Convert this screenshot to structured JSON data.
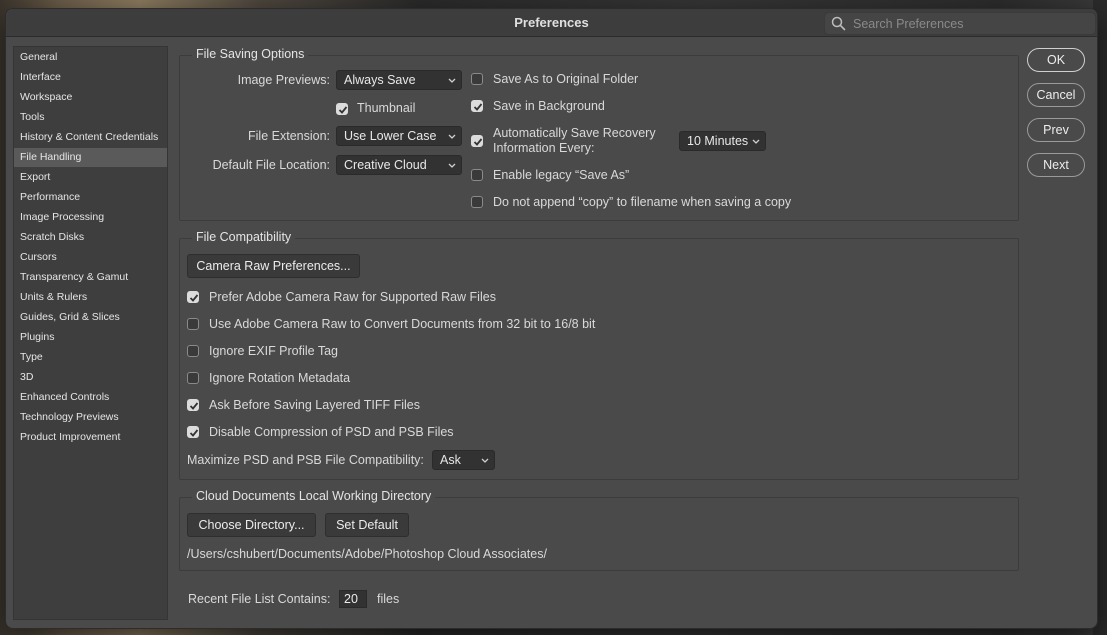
{
  "window": {
    "title": "Preferences"
  },
  "search": {
    "placeholder": "Search Preferences"
  },
  "sidebar": {
    "items": [
      {
        "label": "General"
      },
      {
        "label": "Interface"
      },
      {
        "label": "Workspace"
      },
      {
        "label": "Tools"
      },
      {
        "label": "History & Content Credentials"
      },
      {
        "label": "File Handling"
      },
      {
        "label": "Export"
      },
      {
        "label": "Performance"
      },
      {
        "label": "Image Processing"
      },
      {
        "label": "Scratch Disks"
      },
      {
        "label": "Cursors"
      },
      {
        "label": "Transparency & Gamut"
      },
      {
        "label": "Units & Rulers"
      },
      {
        "label": "Guides, Grid & Slices"
      },
      {
        "label": "Plugins"
      },
      {
        "label": "Type"
      },
      {
        "label": "3D"
      },
      {
        "label": "Enhanced Controls"
      },
      {
        "label": "Technology Previews"
      },
      {
        "label": "Product Improvement"
      }
    ],
    "active": "File Handling"
  },
  "file_saving": {
    "title": "File Saving Options",
    "image_previews_label": "Image Previews:",
    "image_previews_value": "Always Save",
    "thumbnail_label": "Thumbnail",
    "thumbnail_checked": true,
    "file_extension_label": "File Extension:",
    "file_extension_value": "Use Lower Case",
    "default_location_label": "Default File Location:",
    "default_location_value": "Creative Cloud",
    "save_as_original_label": "Save As to Original Folder",
    "save_as_original_checked": false,
    "save_background_label": "Save in Background",
    "save_background_checked": true,
    "auto_recovery_label_1": "Automatically Save Recovery",
    "auto_recovery_label_2": "Information Every:",
    "auto_recovery_checked": true,
    "auto_recovery_value": "10 Minutes",
    "legacy_save_as_label": "Enable legacy “Save As”",
    "legacy_save_as_checked": false,
    "no_copy_label": "Do not append “copy” to filename when saving a copy",
    "no_copy_checked": false
  },
  "file_compat": {
    "title": "File Compatibility",
    "camera_raw_button": "Camera Raw Preferences...",
    "options": [
      {
        "label": "Prefer Adobe Camera Raw for Supported Raw Files",
        "checked": true
      },
      {
        "label": "Use Adobe Camera Raw to Convert Documents from 32 bit to 16/8 bit",
        "checked": false
      },
      {
        "label": "Ignore EXIF Profile Tag",
        "checked": false
      },
      {
        "label": "Ignore Rotation Metadata",
        "checked": false
      },
      {
        "label": "Ask Before Saving Layered TIFF Files",
        "checked": true
      },
      {
        "label": "Disable Compression of PSD and PSB Files",
        "checked": true
      }
    ],
    "maximize_label": "Maximize PSD and PSB File Compatibility:",
    "maximize_value": "Ask"
  },
  "cloud_docs": {
    "title": "Cloud Documents Local Working Directory",
    "choose_button": "Choose Directory...",
    "default_button": "Set Default",
    "path": "/Users/cshubert/Documents/Adobe/Photoshop Cloud Associates/"
  },
  "recent_files": {
    "label": "Recent File List Contains:",
    "value": "20",
    "unit": "files"
  },
  "actions": {
    "ok": "OK",
    "cancel": "Cancel",
    "prev": "Prev",
    "next": "Next"
  }
}
